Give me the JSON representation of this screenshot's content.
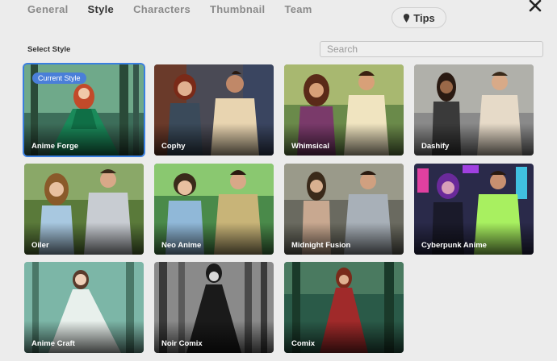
{
  "tabs": [
    "General",
    "Style",
    "Characters",
    "Thumbnail",
    "Team"
  ],
  "active_tab": "Style",
  "tips_label": "Tips",
  "section_label": "Select Style",
  "search": {
    "placeholder": "Search",
    "value": ""
  },
  "current_badge": "Current Style",
  "styles": [
    {
      "name": "Anime Forge",
      "selected": true
    },
    {
      "name": "Cophy"
    },
    {
      "name": "Whimsical"
    },
    {
      "name": "Dashify"
    },
    {
      "name": "Oiler"
    },
    {
      "name": "Neo Anime"
    },
    {
      "name": "Midnight Fusion"
    },
    {
      "name": "Cyberpunk Anime"
    },
    {
      "name": "Anime Craft"
    },
    {
      "name": "Noir Comix"
    },
    {
      "name": "Comix"
    }
  ],
  "colors": {
    "selected_border": "#3a7fe0",
    "badge_bg": "#4a7fd8"
  }
}
